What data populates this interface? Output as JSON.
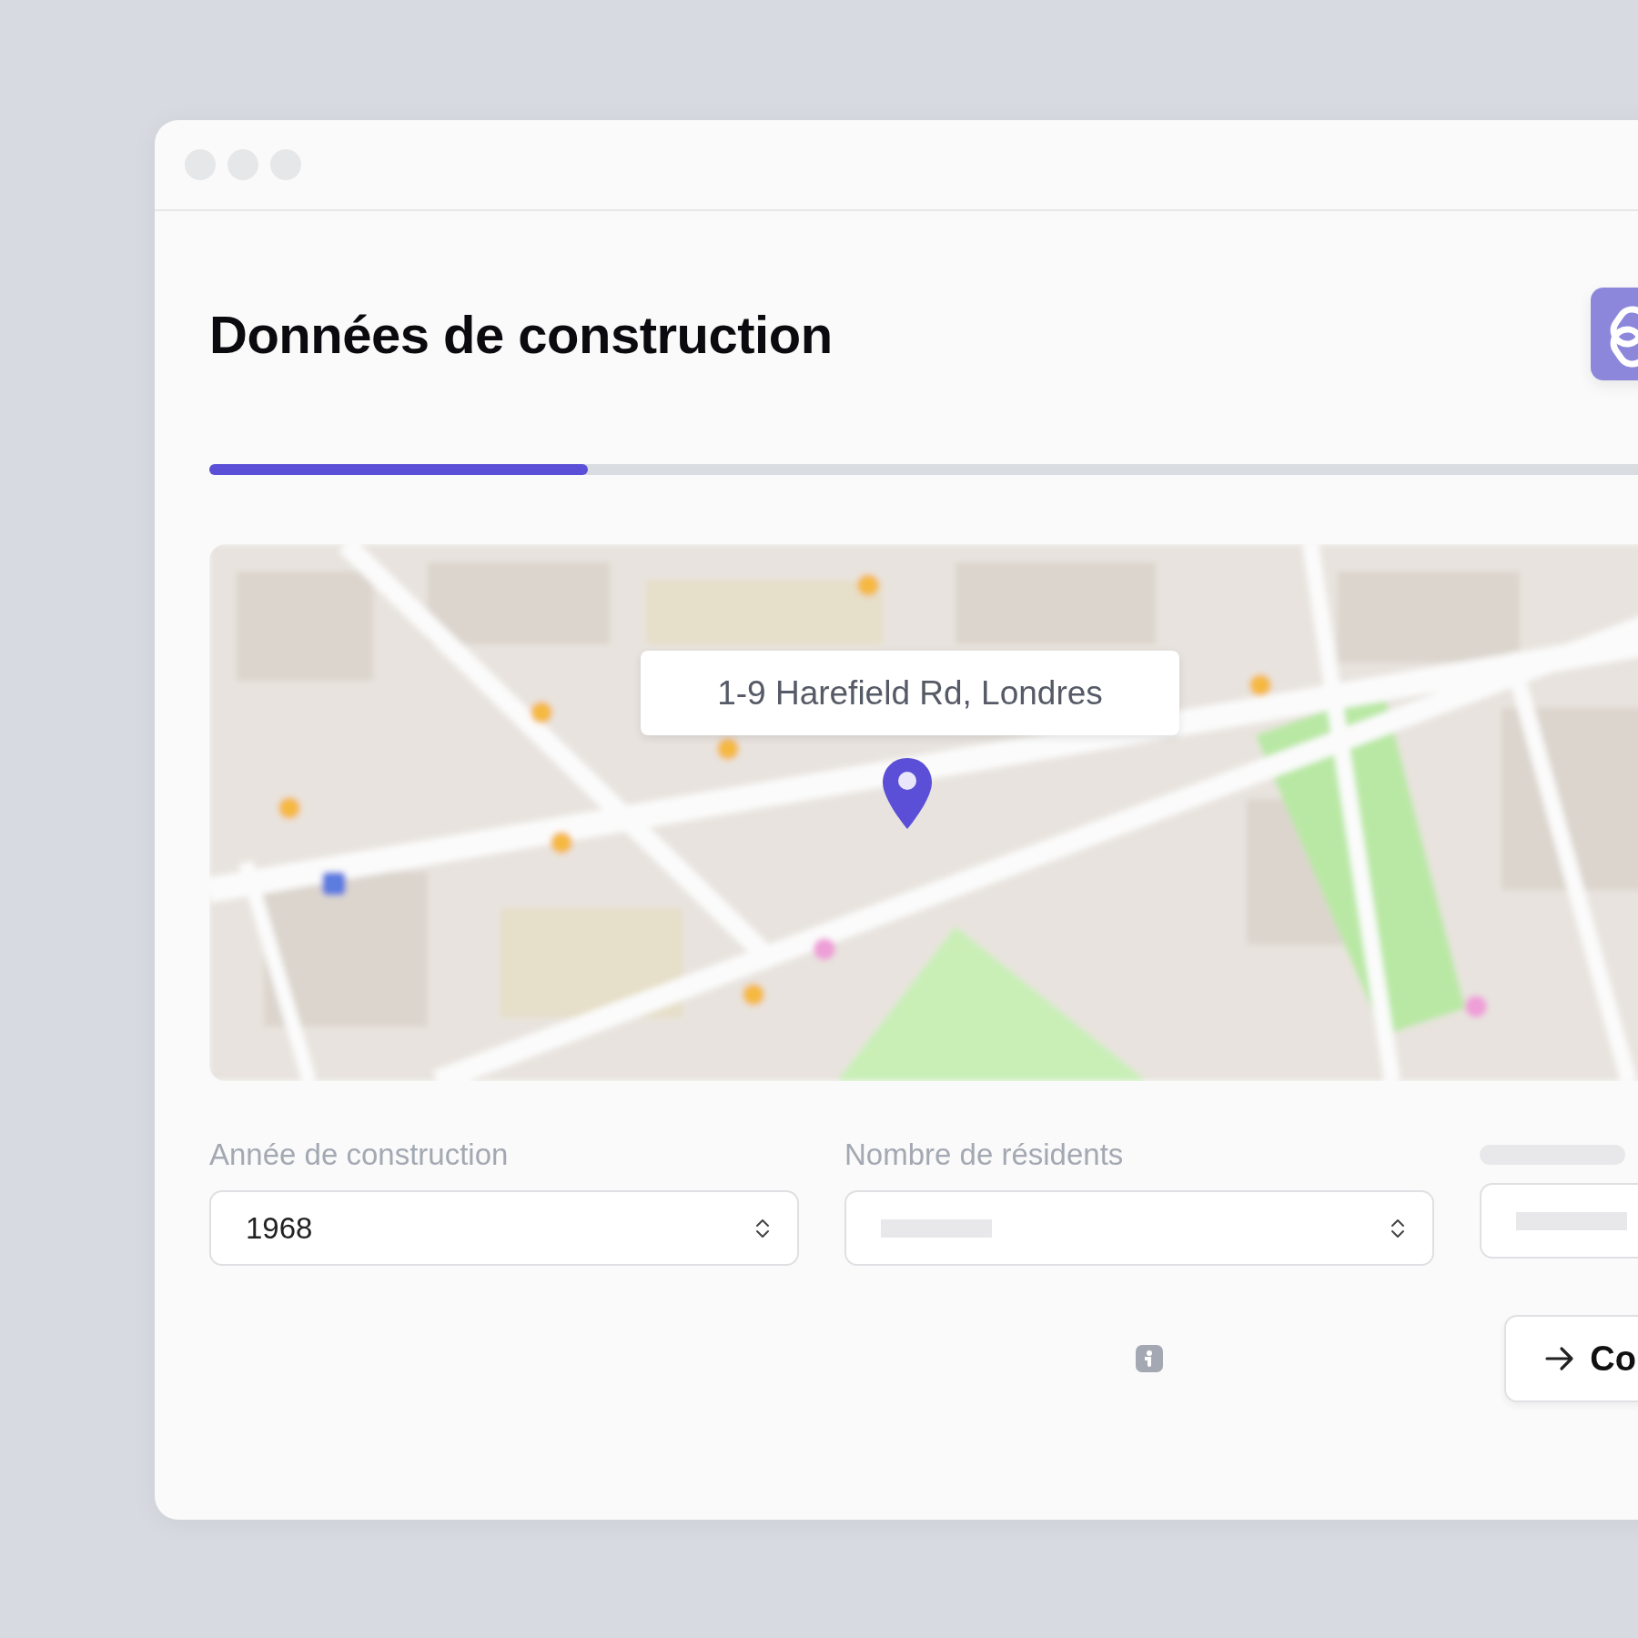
{
  "page": {
    "title": "Données de construction"
  },
  "progress": {
    "level": 0.255
  },
  "map": {
    "address": "1-9 Harefield Rd, Londres"
  },
  "fields": [
    {
      "kind": "select",
      "label": "Année de construction",
      "value": "1968"
    },
    {
      "kind": "select",
      "label": "Nombre de résidents"
    },
    {
      "kind": "input"
    }
  ],
  "button": {
    "label": "Co"
  }
}
